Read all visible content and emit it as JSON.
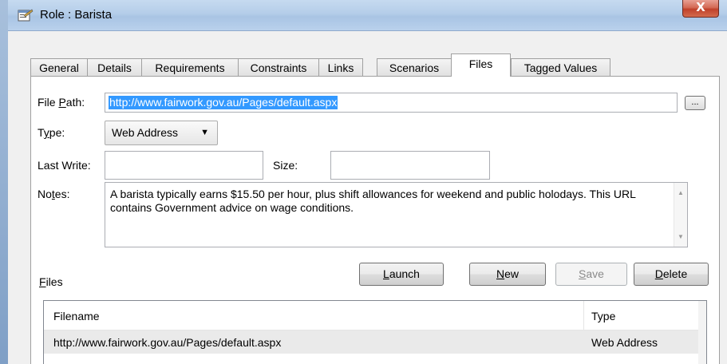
{
  "window": {
    "title": "Role : Barista",
    "close_label": "X"
  },
  "tabs": [
    {
      "label": "General"
    },
    {
      "label": "Details"
    },
    {
      "label": "Requirements"
    },
    {
      "label": "Constraints"
    },
    {
      "label": "Links"
    },
    {
      "label": "Scenarios"
    },
    {
      "label": "Files",
      "active": true
    },
    {
      "label": "Tagged Values"
    }
  ],
  "form": {
    "file_path_label_pre": "File ",
    "file_path_label_u": "P",
    "file_path_label_post": "ath:",
    "file_path_value": "http://www.fairwork.gov.au/Pages/default.aspx",
    "browse_label": "...",
    "type_label_pre": "T",
    "type_label_u": "y",
    "type_label_post": "pe:",
    "type_value": "Web Address",
    "last_write_label": "Last Write:",
    "last_write_value": "",
    "size_label": "Size:",
    "size_value": "",
    "notes_label_pre": "No",
    "notes_label_u": "t",
    "notes_label_post": "es:",
    "notes_value": "A barista typically earns $15.50 per hour, plus shift allowances for weekend and public holodays.  This URL contains Government advice on wage conditions."
  },
  "buttons": {
    "launch_u": "L",
    "launch_rest": "aunch",
    "new_u": "N",
    "new_rest": "ew",
    "save_u": "S",
    "save_rest": "ave",
    "delete_u": "D",
    "delete_rest": "elete"
  },
  "files": {
    "label_u": "F",
    "label_rest": "iles",
    "columns": [
      "Filename",
      "Type"
    ],
    "rows": [
      {
        "filename": "http://www.fairwork.gov.au/Pages/default.aspx",
        "type": "Web Address"
      }
    ]
  }
}
